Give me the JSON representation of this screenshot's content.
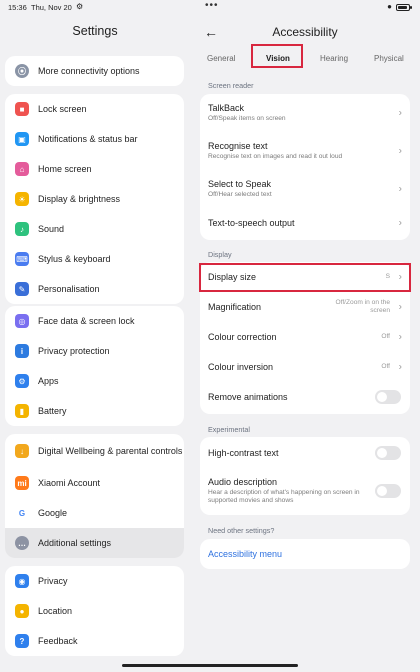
{
  "status": {
    "time": "15:36",
    "date": "Thu, Nov 20",
    "dots": "•••"
  },
  "left": {
    "title": "Settings",
    "groups": [
      [
        {
          "label": "More connectivity options",
          "icon": "link-icon",
          "color": "#8a94a6",
          "glyph": "⦿"
        }
      ],
      [
        {
          "label": "Lock screen",
          "icon": "lock-icon",
          "color": "#ef5350",
          "glyph": "■"
        },
        {
          "label": "Notifications & status bar",
          "icon": "notification-icon",
          "color": "#2196f3",
          "glyph": "▣"
        },
        {
          "label": "Home screen",
          "icon": "home-icon",
          "color": "#e45c9b",
          "glyph": "⌂"
        },
        {
          "label": "Display & brightness",
          "icon": "sun-icon",
          "color": "#f5b400",
          "glyph": "☀"
        },
        {
          "label": "Sound",
          "icon": "speaker-icon",
          "color": "#2ec27e",
          "glyph": "♪"
        },
        {
          "label": "Stylus & keyboard",
          "icon": "keyboard-icon",
          "color": "#4a7cf0",
          "glyph": "⌨"
        },
        {
          "label": "Personalisation",
          "icon": "brush-icon",
          "color": "#3a6fd8",
          "glyph": "✎"
        }
      ],
      [
        {
          "label": "Face data & screen lock",
          "icon": "fingerprint-icon",
          "color": "#7a6ff0",
          "glyph": "◎"
        },
        {
          "label": "Privacy protection",
          "icon": "privacy-icon",
          "color": "#2d7be0",
          "glyph": "i"
        },
        {
          "label": "Apps",
          "icon": "apps-icon",
          "color": "#2f80ed",
          "glyph": "⚙"
        },
        {
          "label": "Battery",
          "icon": "battery-icon",
          "color": "#f4b400",
          "glyph": "▮"
        }
      ],
      [
        {
          "label": "Digital Wellbeing & parental controls",
          "icon": "wellbeing-icon",
          "color": "#f2a81d",
          "glyph": "↓",
          "tall": true
        },
        {
          "label": "Xiaomi Account",
          "icon": "mi-account-icon",
          "color": "#ff7a1a",
          "glyph": "mi"
        },
        {
          "label": "Google",
          "icon": "google-icon",
          "color": "#ffffff",
          "glyph": "G",
          "glyphColor": "#4285f4"
        },
        {
          "label": "Additional settings",
          "icon": "more-icon",
          "color": "#8d93a3",
          "glyph": "…",
          "active": true
        }
      ],
      [
        {
          "label": "Privacy",
          "icon": "eye-icon",
          "color": "#2f80ed",
          "glyph": "◉"
        },
        {
          "label": "Location",
          "icon": "location-icon",
          "color": "#f4b400",
          "glyph": "●"
        },
        {
          "label": "Feedback",
          "icon": "feedback-icon",
          "color": "#2f80ed",
          "glyph": "?"
        }
      ]
    ]
  },
  "right": {
    "title": "Accessibility",
    "tabs": [
      "General",
      "Vision",
      "Hearing",
      "Physical"
    ],
    "sections": {
      "screen_reader": "Screen reader",
      "display": "Display",
      "experimental": "Experimental",
      "need_other": "Need other settings?"
    },
    "talkback": {
      "title": "TalkBack",
      "sub": "Off/Speak items on screen"
    },
    "recognise": {
      "title": "Recognise text",
      "sub": "Recognise text on images and read it out loud"
    },
    "select_to_speak": {
      "title": "Select to Speak",
      "sub": "Off/Hear selected text"
    },
    "tts": {
      "title": "Text-to-speech output"
    },
    "display_size": {
      "title": "Display size",
      "value": "S"
    },
    "magnification": {
      "title": "Magnification",
      "value": "Off/Zoom in on the screen"
    },
    "colour_correction": {
      "title": "Colour correction",
      "value": "Off"
    },
    "colour_inversion": {
      "title": "Colour inversion",
      "value": "Off"
    },
    "remove_animations": {
      "title": "Remove animations"
    },
    "high_contrast": {
      "title": "High-contrast text"
    },
    "audio_description": {
      "title": "Audio description",
      "sub": "Hear a description of what's happening on screen in supported movies and shows"
    },
    "accessibility_menu": "Accessibility menu"
  }
}
